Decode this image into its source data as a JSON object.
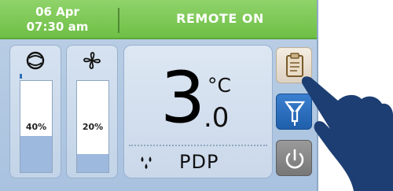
{
  "header": {
    "date": "06 Apr",
    "time": "07:30 am",
    "remote_status": "REMOTE ON"
  },
  "gauges": [
    {
      "name": "compressor",
      "icon": "compressor-icon",
      "label": "40%",
      "level": 0.4
    },
    {
      "name": "fan",
      "icon": "fan-icon",
      "label": "20%",
      "level": 0.2
    }
  ],
  "dew_point": {
    "digit": "3",
    "unit": "°C",
    "decimal": ".0",
    "label": "PDP",
    "icon": "droplets-icon"
  },
  "side_buttons": [
    {
      "name": "report-button",
      "icon": "clipboard-icon"
    },
    {
      "name": "filter-button",
      "icon": "filter-drain-icon"
    },
    {
      "name": "power-button",
      "icon": "power-icon"
    }
  ],
  "colors": {
    "header_green": "#7cc653",
    "panel_blue": "#bcd0e6",
    "filter_button_blue": "#2a6cbd",
    "hand_navy": "#1d3e73"
  }
}
